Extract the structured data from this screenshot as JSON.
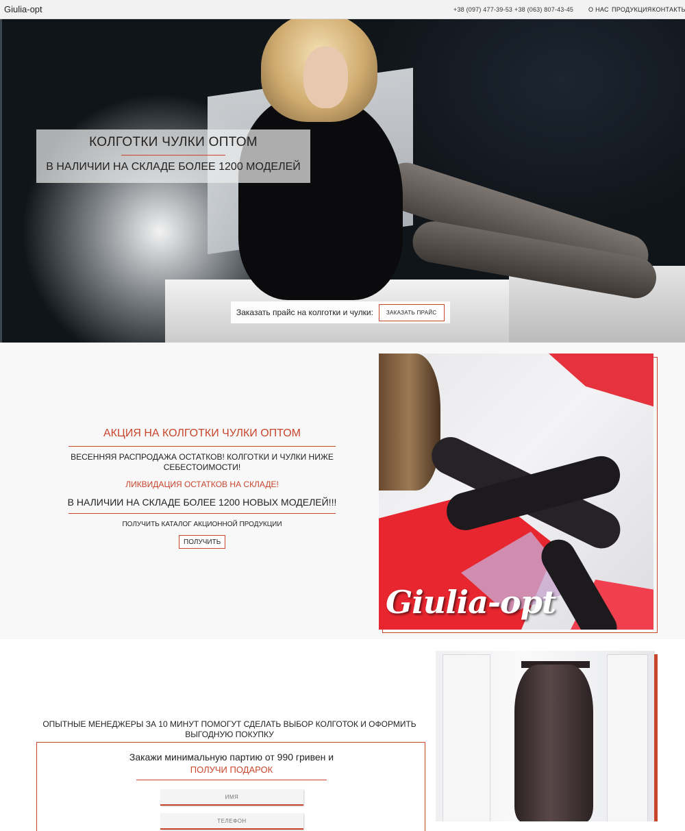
{
  "nav": {
    "logo": "Giulia-opt",
    "phone1": "+38 (097) 477-39-53",
    "phone2": "+38 (063) 807-43-45",
    "menu": [
      "О НАС",
      "ПРОДУКЦИЯ",
      "КОНТАКТЫ"
    ]
  },
  "hero": {
    "title": "КОЛГОТКИ ЧУЛКИ ОПТОМ",
    "subtitle": "В НАЛИЧИИ НА СКЛАДЕ БОЛЕЕ 1200 МОДЕЛЕЙ",
    "order_text": "Заказать прайс на колготки и чулки:",
    "order_button": "ЗАКАЗАТЬ ПРАЙС"
  },
  "promo": {
    "title": "АКЦИЯ НА КОЛГОТКИ ЧУЛКИ ОПТОМ",
    "line1": "ВЕСЕННЯЯ РАСПРОДАЖА ОСТАТКОВ! КОЛГОТКИ И ЧУЛКИ НИЖЕ СЕБЕСТОИМОСТИ!",
    "line2": "ЛИКВИДАЦИЯ ОСТАТКОВ НА СКЛАДЕ!",
    "line3": "В НАЛИЧИИ НА СКЛАДЕ БОЛЕЕ 1200 НОВЫХ МОДЕЛЕЙ!!!",
    "catalog_text": "ПОЛУЧИТЬ КАТАЛОГ АКЦИОННОЙ ПРОДУКЦИИ",
    "get_button": "ПОЛУЧИТЬ",
    "image_brand": "Giulia-opt"
  },
  "order": {
    "heading": "ОПЫТНЫЕ МЕНЕДЖЕРЫ ЗА 10 МИНУТ ПОМОГУТ СДЕЛАТЬ ВЫБОР КОЛГОТОК И ОФОРМИТЬ ВЫГОДНУЮ ПОКУПКУ",
    "offer_line1": "Закажи минимальную партию от 990 гривен и",
    "offer_line2": "ПОЛУЧИ ПОДАРОК",
    "name_placeholder": "ИМЯ",
    "phone_placeholder": "ТЕЛЕФОН"
  },
  "colors": {
    "accent": "#c8442b",
    "nav_bg": "#f2f2f2",
    "section_bg": "#f8f8f8"
  }
}
